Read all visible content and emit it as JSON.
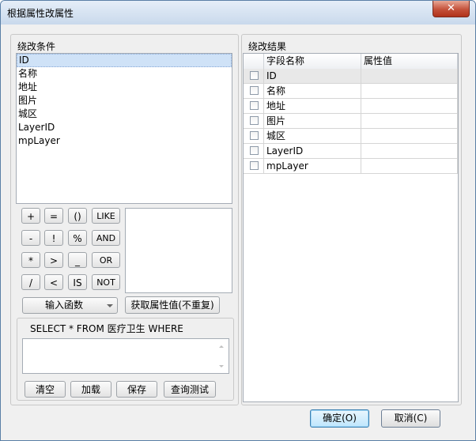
{
  "window": {
    "title": "根据属性改属性",
    "close": "✕"
  },
  "left_panel": {
    "title": "绕改条件",
    "fields": [
      "ID",
      "名称",
      "地址",
      "图片",
      "城区",
      "LayerID",
      "mpLayer"
    ],
    "selected_index": 0,
    "operators": {
      "row1": [
        "+",
        "=",
        "()",
        "LIKE"
      ],
      "row2": [
        "-",
        "!",
        "%",
        "AND"
      ],
      "row3": [
        "*",
        ">",
        "_",
        "OR"
      ],
      "row4": [
        "/",
        "<",
        "IS",
        "NOT"
      ]
    },
    "function_combo": "输入函数",
    "get_values_button": "获取属性值(不重复)",
    "sql_prefix": "SELECT * FROM 医疗卫生 WHERE",
    "sql_value": "",
    "buttons": {
      "clear": "清空",
      "load": "加载",
      "save": "保存",
      "test": "查询测试"
    }
  },
  "right_panel": {
    "title": "绕改结果",
    "columns": {
      "field": "字段名称",
      "value": "属性值"
    },
    "rows": [
      {
        "field": "ID",
        "value": "",
        "checked": false
      },
      {
        "field": "名称",
        "value": "",
        "checked": false
      },
      {
        "field": "地址",
        "value": "",
        "checked": false
      },
      {
        "field": "图片",
        "value": "",
        "checked": false
      },
      {
        "field": "城区",
        "value": "",
        "checked": false
      },
      {
        "field": "LayerID",
        "value": "",
        "checked": false
      },
      {
        "field": "mpLayer",
        "value": "",
        "checked": false
      }
    ]
  },
  "footer": {
    "ok": "确定(O)",
    "cancel": "取消(C)"
  }
}
